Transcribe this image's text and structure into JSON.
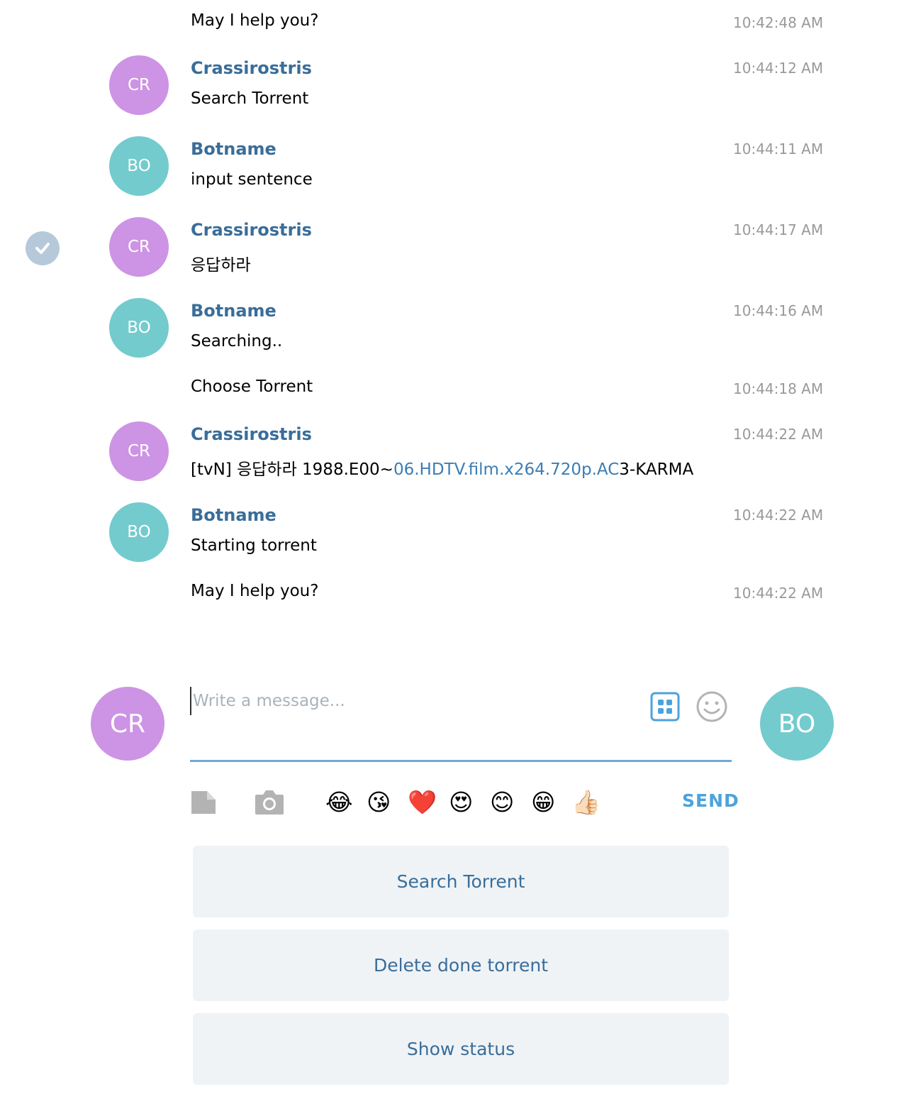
{
  "messages": {
    "m0_text": "May I help you?",
    "m0_time": "10:42:48 AM",
    "m1_initials": "CR",
    "m1_sender": "Crassirostris",
    "m1_text": "Search Torrent",
    "m1_time": "10:44:12 AM",
    "m2_initials": "BO",
    "m2_sender": "Botname",
    "m2_text": "input sentence",
    "m2_time": "10:44:11 AM",
    "m3_initials": "CR",
    "m3_sender": "Crassirostris",
    "m3_text": "응답하라",
    "m3_time": "10:44:17 AM",
    "m4_initials": "BO",
    "m4_sender": "Botname",
    "m4_text": "Searching..",
    "m4_time": "10:44:16 AM",
    "m5_text": "Choose Torrent",
    "m5_time": "10:44:18 AM",
    "m6_initials": "CR",
    "m6_sender": "Crassirostris",
    "m6_text_a": "[tvN] 응답하라 1988.E00~",
    "m6_text_link": "06.HDTV.film.x264.720p.AC",
    "m6_text_b": "3-KARMA",
    "m6_time": "10:44:22 AM",
    "m7_initials": "BO",
    "m7_sender": "Botname",
    "m7_text": "Starting torrent",
    "m7_time": "10:44:22 AM",
    "m8_text": "May I help you?",
    "m8_time": "10:44:22 AM"
  },
  "composer": {
    "user_initials": "CR",
    "bot_initials": "BO",
    "placeholder": "Write a message...",
    "send_label": "SEND",
    "emojis": [
      "😂",
      "😘",
      "❤️",
      "😍",
      "😊",
      "😁",
      "👍🏻"
    ]
  },
  "keyboard": {
    "buttons": [
      "Search Torrent",
      "Delete done torrent",
      "Show status"
    ]
  },
  "colors": {
    "user_avatar": "#cd93e4",
    "bot_avatar": "#73cbce",
    "sender_name": "#3a6d99",
    "accent": "#4ba3dd"
  },
  "icons": [
    "check-icon",
    "file-icon",
    "camera-icon",
    "bot-command-icon",
    "smiley-icon"
  ]
}
